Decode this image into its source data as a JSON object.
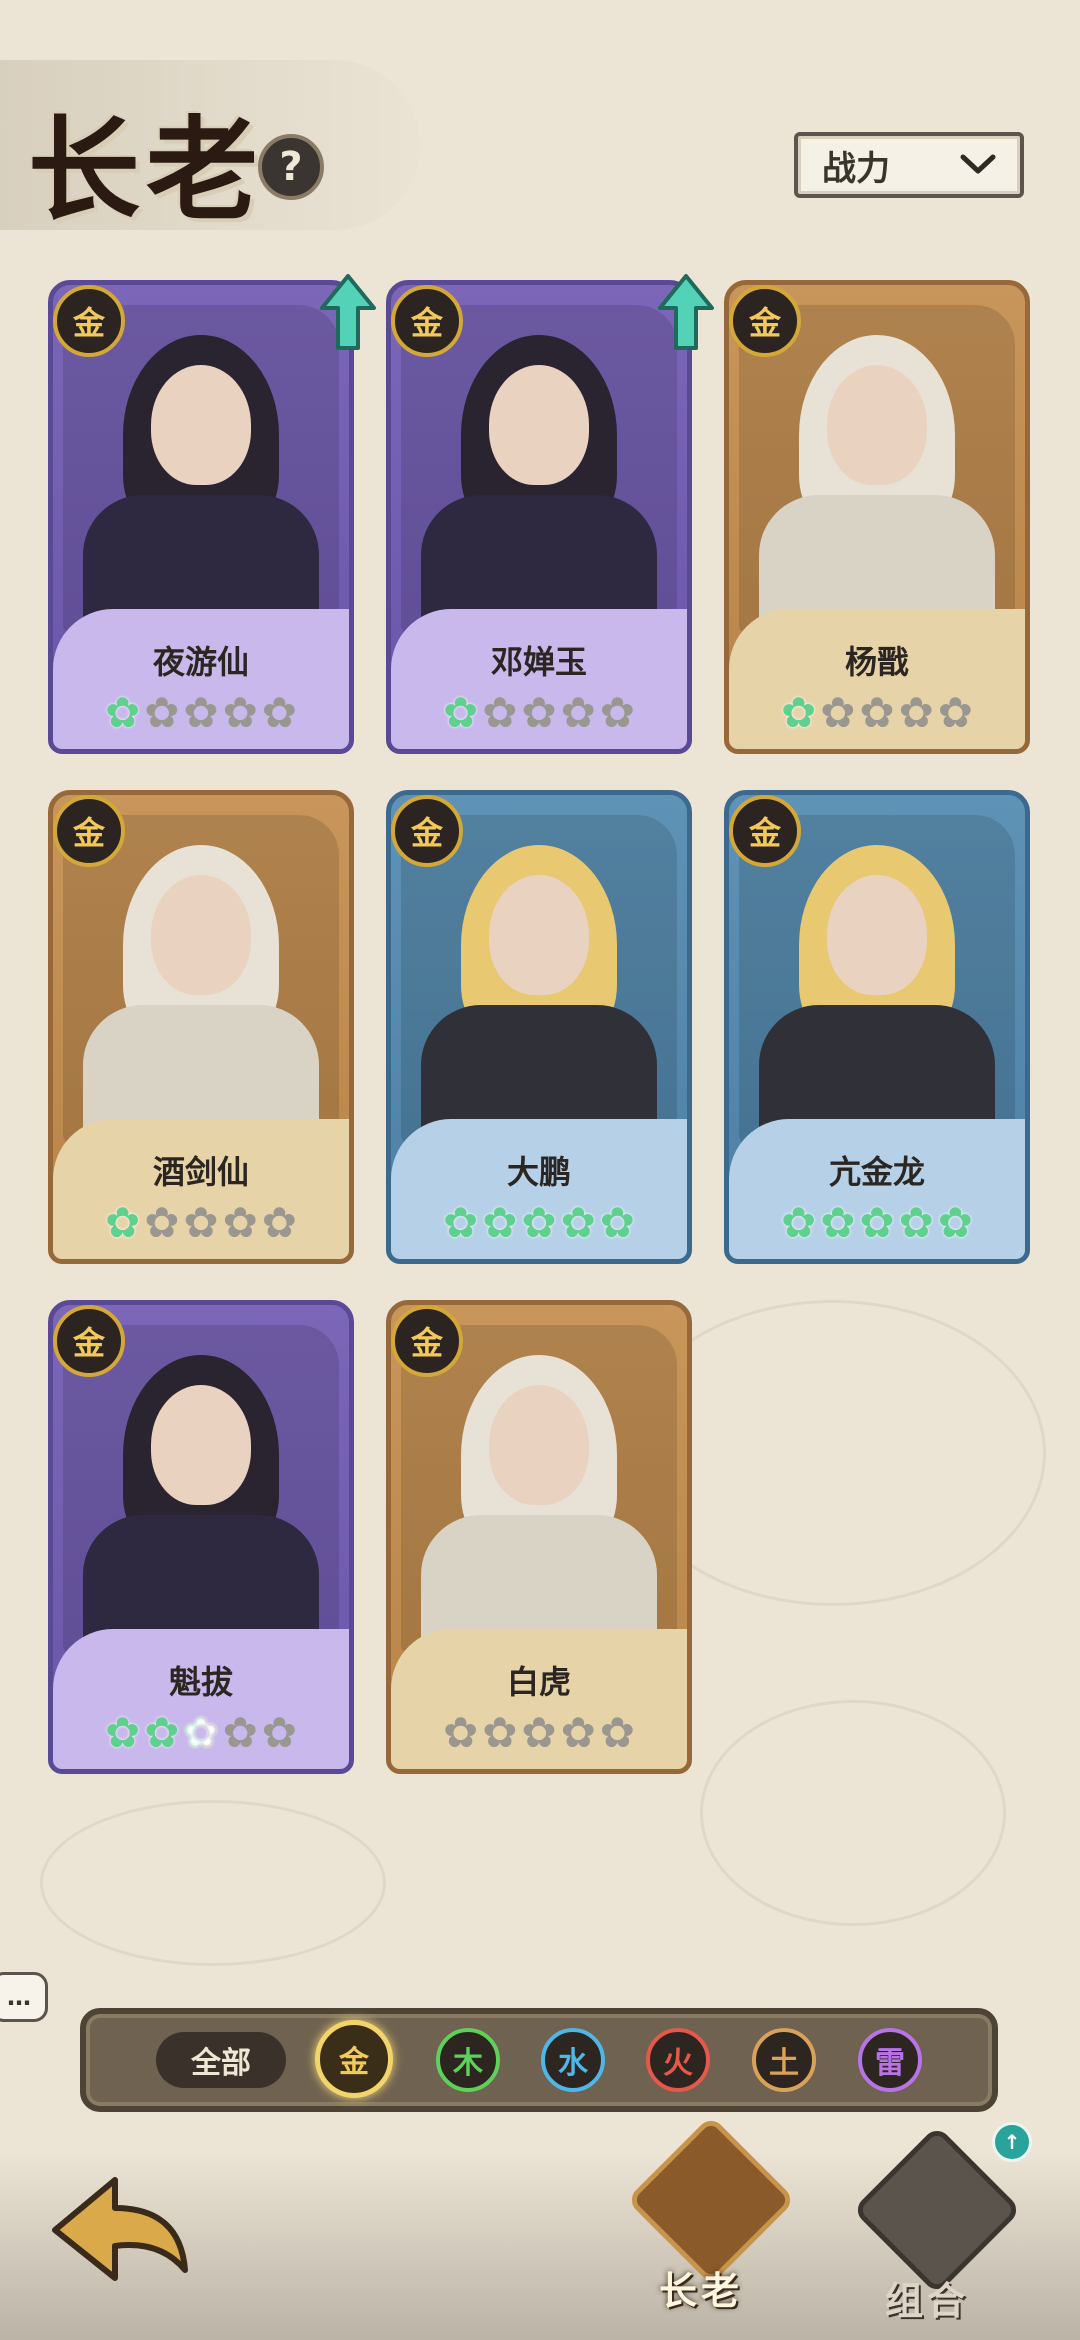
{
  "header": {
    "title": "长老",
    "help_symbol": "?",
    "sort_label": "战力",
    "sort_icon": "chevron-down-icon"
  },
  "heroes": [
    {
      "name": "夜游仙",
      "element_badge": "金",
      "frame": "purple",
      "stars_filled": 1,
      "stars_total": 5,
      "upgrade_available": true
    },
    {
      "name": "邓婵玉",
      "element_badge": "金",
      "frame": "purple",
      "stars_filled": 1,
      "stars_total": 5,
      "upgrade_available": true
    },
    {
      "name": "杨戬",
      "element_badge": "金",
      "frame": "gold",
      "stars_filled": 1,
      "stars_total": 5,
      "upgrade_available": false
    },
    {
      "name": "酒剑仙",
      "element_badge": "金",
      "frame": "gold",
      "stars_filled": 1,
      "stars_total": 5,
      "upgrade_available": false
    },
    {
      "name": "大鹏",
      "element_badge": "金",
      "frame": "blue",
      "stars_filled": 5,
      "stars_total": 5,
      "upgrade_available": false
    },
    {
      "name": "亢金龙",
      "element_badge": "金",
      "frame": "blue",
      "stars_filled": 5,
      "stars_total": 5,
      "upgrade_available": false
    },
    {
      "name": "魁拔",
      "element_badge": "金",
      "frame": "purple",
      "stars_filled": 2.5,
      "stars_total": 5,
      "upgrade_available": false
    },
    {
      "name": "白虎",
      "element_badge": "金",
      "frame": "gold",
      "stars_filled": 0,
      "stars_total": 5,
      "upgrade_available": false
    }
  ],
  "filter": {
    "all_label": "全部",
    "elements": [
      {
        "label": "金",
        "color": "#f2c95a",
        "active": true
      },
      {
        "label": "木",
        "color": "#5fd05a",
        "active": false
      },
      {
        "label": "水",
        "color": "#4fb6e6",
        "active": false
      },
      {
        "label": "火",
        "color": "#e6584a",
        "active": false
      },
      {
        "label": "土",
        "color": "#d9a25a",
        "active": false
      },
      {
        "label": "雷",
        "color": "#b873e6",
        "active": false
      }
    ]
  },
  "bottom_nav": {
    "tabs": [
      {
        "label": "长老",
        "active": true
      },
      {
        "label": "组合",
        "active": false
      }
    ],
    "notification_symbol": "↑"
  },
  "chat_symbol": "…",
  "colors": {
    "background": "#ece5d6",
    "star_on": "#5fd08e",
    "star_off": "#9a9690",
    "badge_gold": "#d4a838"
  }
}
